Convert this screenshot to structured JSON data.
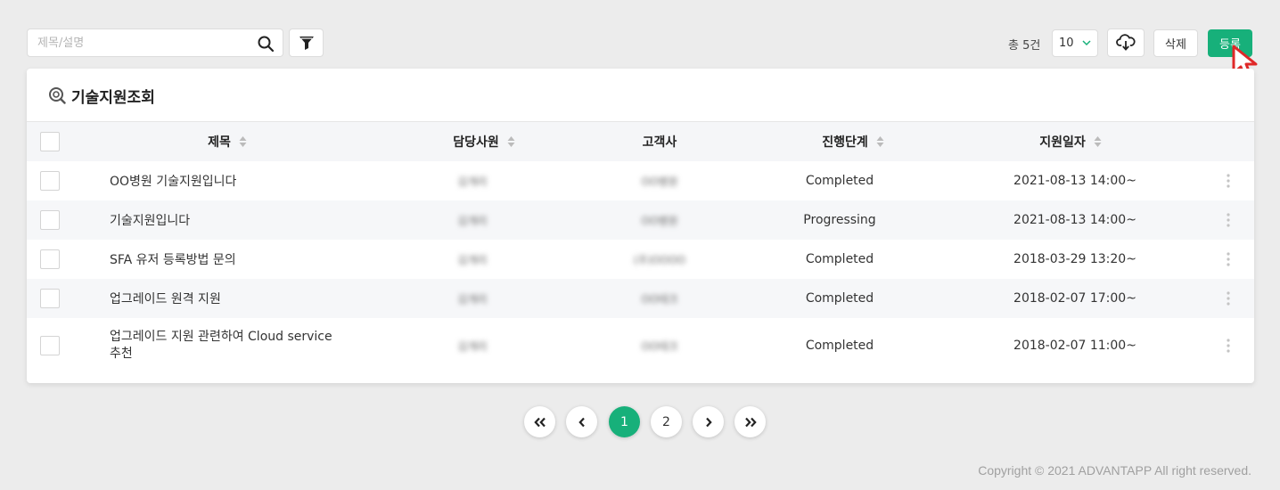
{
  "toolbar": {
    "search_placeholder": "제목/설명",
    "search_value": "",
    "total_label": "총 5건",
    "page_size": "10",
    "delete_label": "삭제",
    "register_label": "등록"
  },
  "card": {
    "title": "기술지원조회",
    "columns": {
      "title": "제목",
      "owner": "담당사원",
      "customer": "고객사",
      "stage": "진행단계",
      "date": "지원일자"
    },
    "rows": [
      {
        "title": "OO병원 기술지원입니다",
        "owner": "김개리",
        "customer": "OO병원",
        "stage": "Completed",
        "date": "2021-08-13 14:00~"
      },
      {
        "title": "기술지원입니다",
        "owner": "김개리",
        "customer": "OO병원",
        "stage": "Progressing",
        "date": "2021-08-13 14:00~"
      },
      {
        "title": "SFA 유저 등록방법 문의",
        "owner": "김개리",
        "customer": "(주)OOOO",
        "stage": "Completed",
        "date": "2018-03-29 13:20~"
      },
      {
        "title": "업그레이드 원격 지원",
        "owner": "김개리",
        "customer": "OO테크",
        "stage": "Completed",
        "date": "2018-02-07 17:00~"
      },
      {
        "title_line1": "업그레이드 지원 관련하여 Cloud service",
        "title_line2": "추천",
        "owner": "김개리",
        "customer": "OO테크",
        "stage": "Completed",
        "date": "2018-02-07 11:00~"
      }
    ]
  },
  "pagination": {
    "first": "«",
    "prev": "‹",
    "pages": [
      "1",
      "2"
    ],
    "current": "1",
    "next": "›",
    "last": "»"
  },
  "footer": {
    "copyright": "Copyright © 2021 ADVANTAPP All right reserved."
  },
  "colors": {
    "accent": "#17b07a",
    "background": "#ececec",
    "header_row": "#f5f6f8"
  },
  "icons": [
    "search-icon",
    "filter-icon",
    "chevron-down-icon",
    "cloud-download-icon",
    "cursor-icon",
    "support-search-icon",
    "sort-icon",
    "more-vertical-icon"
  ]
}
